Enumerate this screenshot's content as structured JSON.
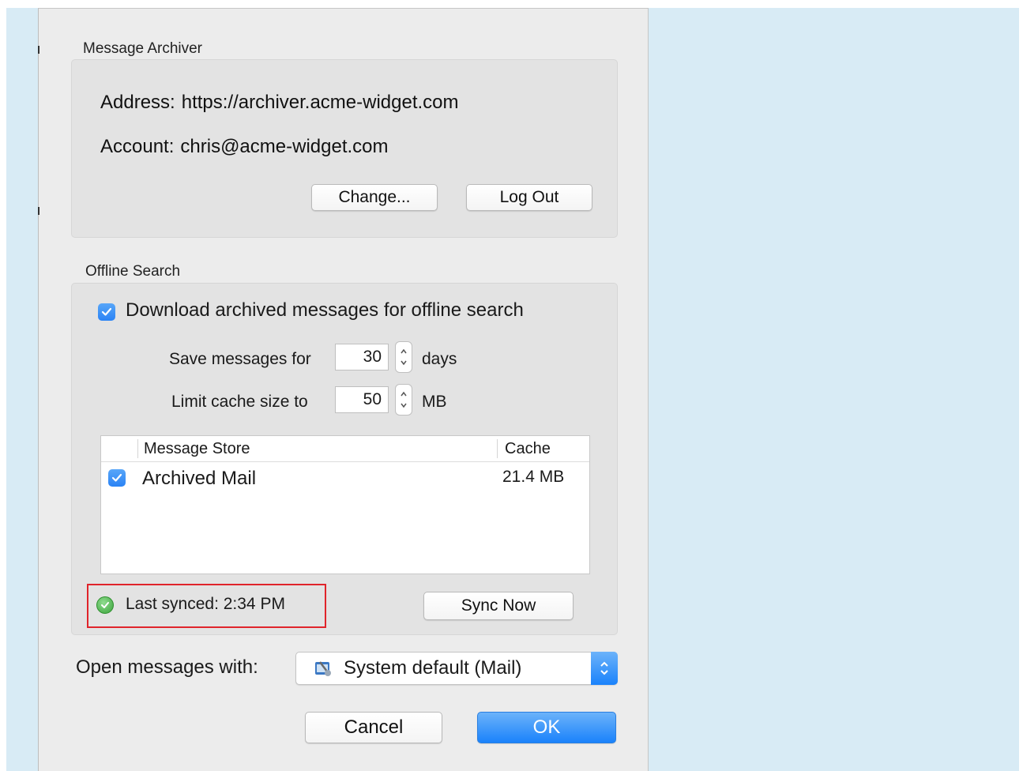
{
  "archiver": {
    "section_title": "Message Archiver",
    "address_label": "Address:",
    "address_value": "https://archiver.acme-widget.com",
    "account_label": "Account:",
    "account_value": "chris@acme-widget.com",
    "change_button": "Change...",
    "logout_button": "Log Out"
  },
  "offline": {
    "section_title": "Offline Search",
    "download_checkbox_label": "Download archived messages for offline search",
    "download_checked": true,
    "save_label": "Save messages for",
    "save_value": "30",
    "save_unit": "days",
    "limit_label": "Limit cache size to",
    "limit_value": "50",
    "limit_unit": "MB",
    "table": {
      "headers": [
        "Message Store",
        "Cache"
      ],
      "rows": [
        {
          "checked": true,
          "name": "Archived Mail",
          "cache": "21.4 MB"
        }
      ]
    },
    "sync_status": "Last synced: 2:34 PM",
    "sync_icon": "green-check-circle-icon",
    "sync_button": "Sync Now"
  },
  "open_with": {
    "label": "Open messages with:",
    "selected": "System default (Mail)",
    "icon": "mail-app-icon"
  },
  "footer": {
    "cancel_button": "Cancel",
    "ok_button": "OK"
  },
  "colors": {
    "accent": "#2a83f5",
    "highlight": "#e0242b",
    "background_right": "#d8ebf5",
    "status_ok": "#4cb84c"
  }
}
